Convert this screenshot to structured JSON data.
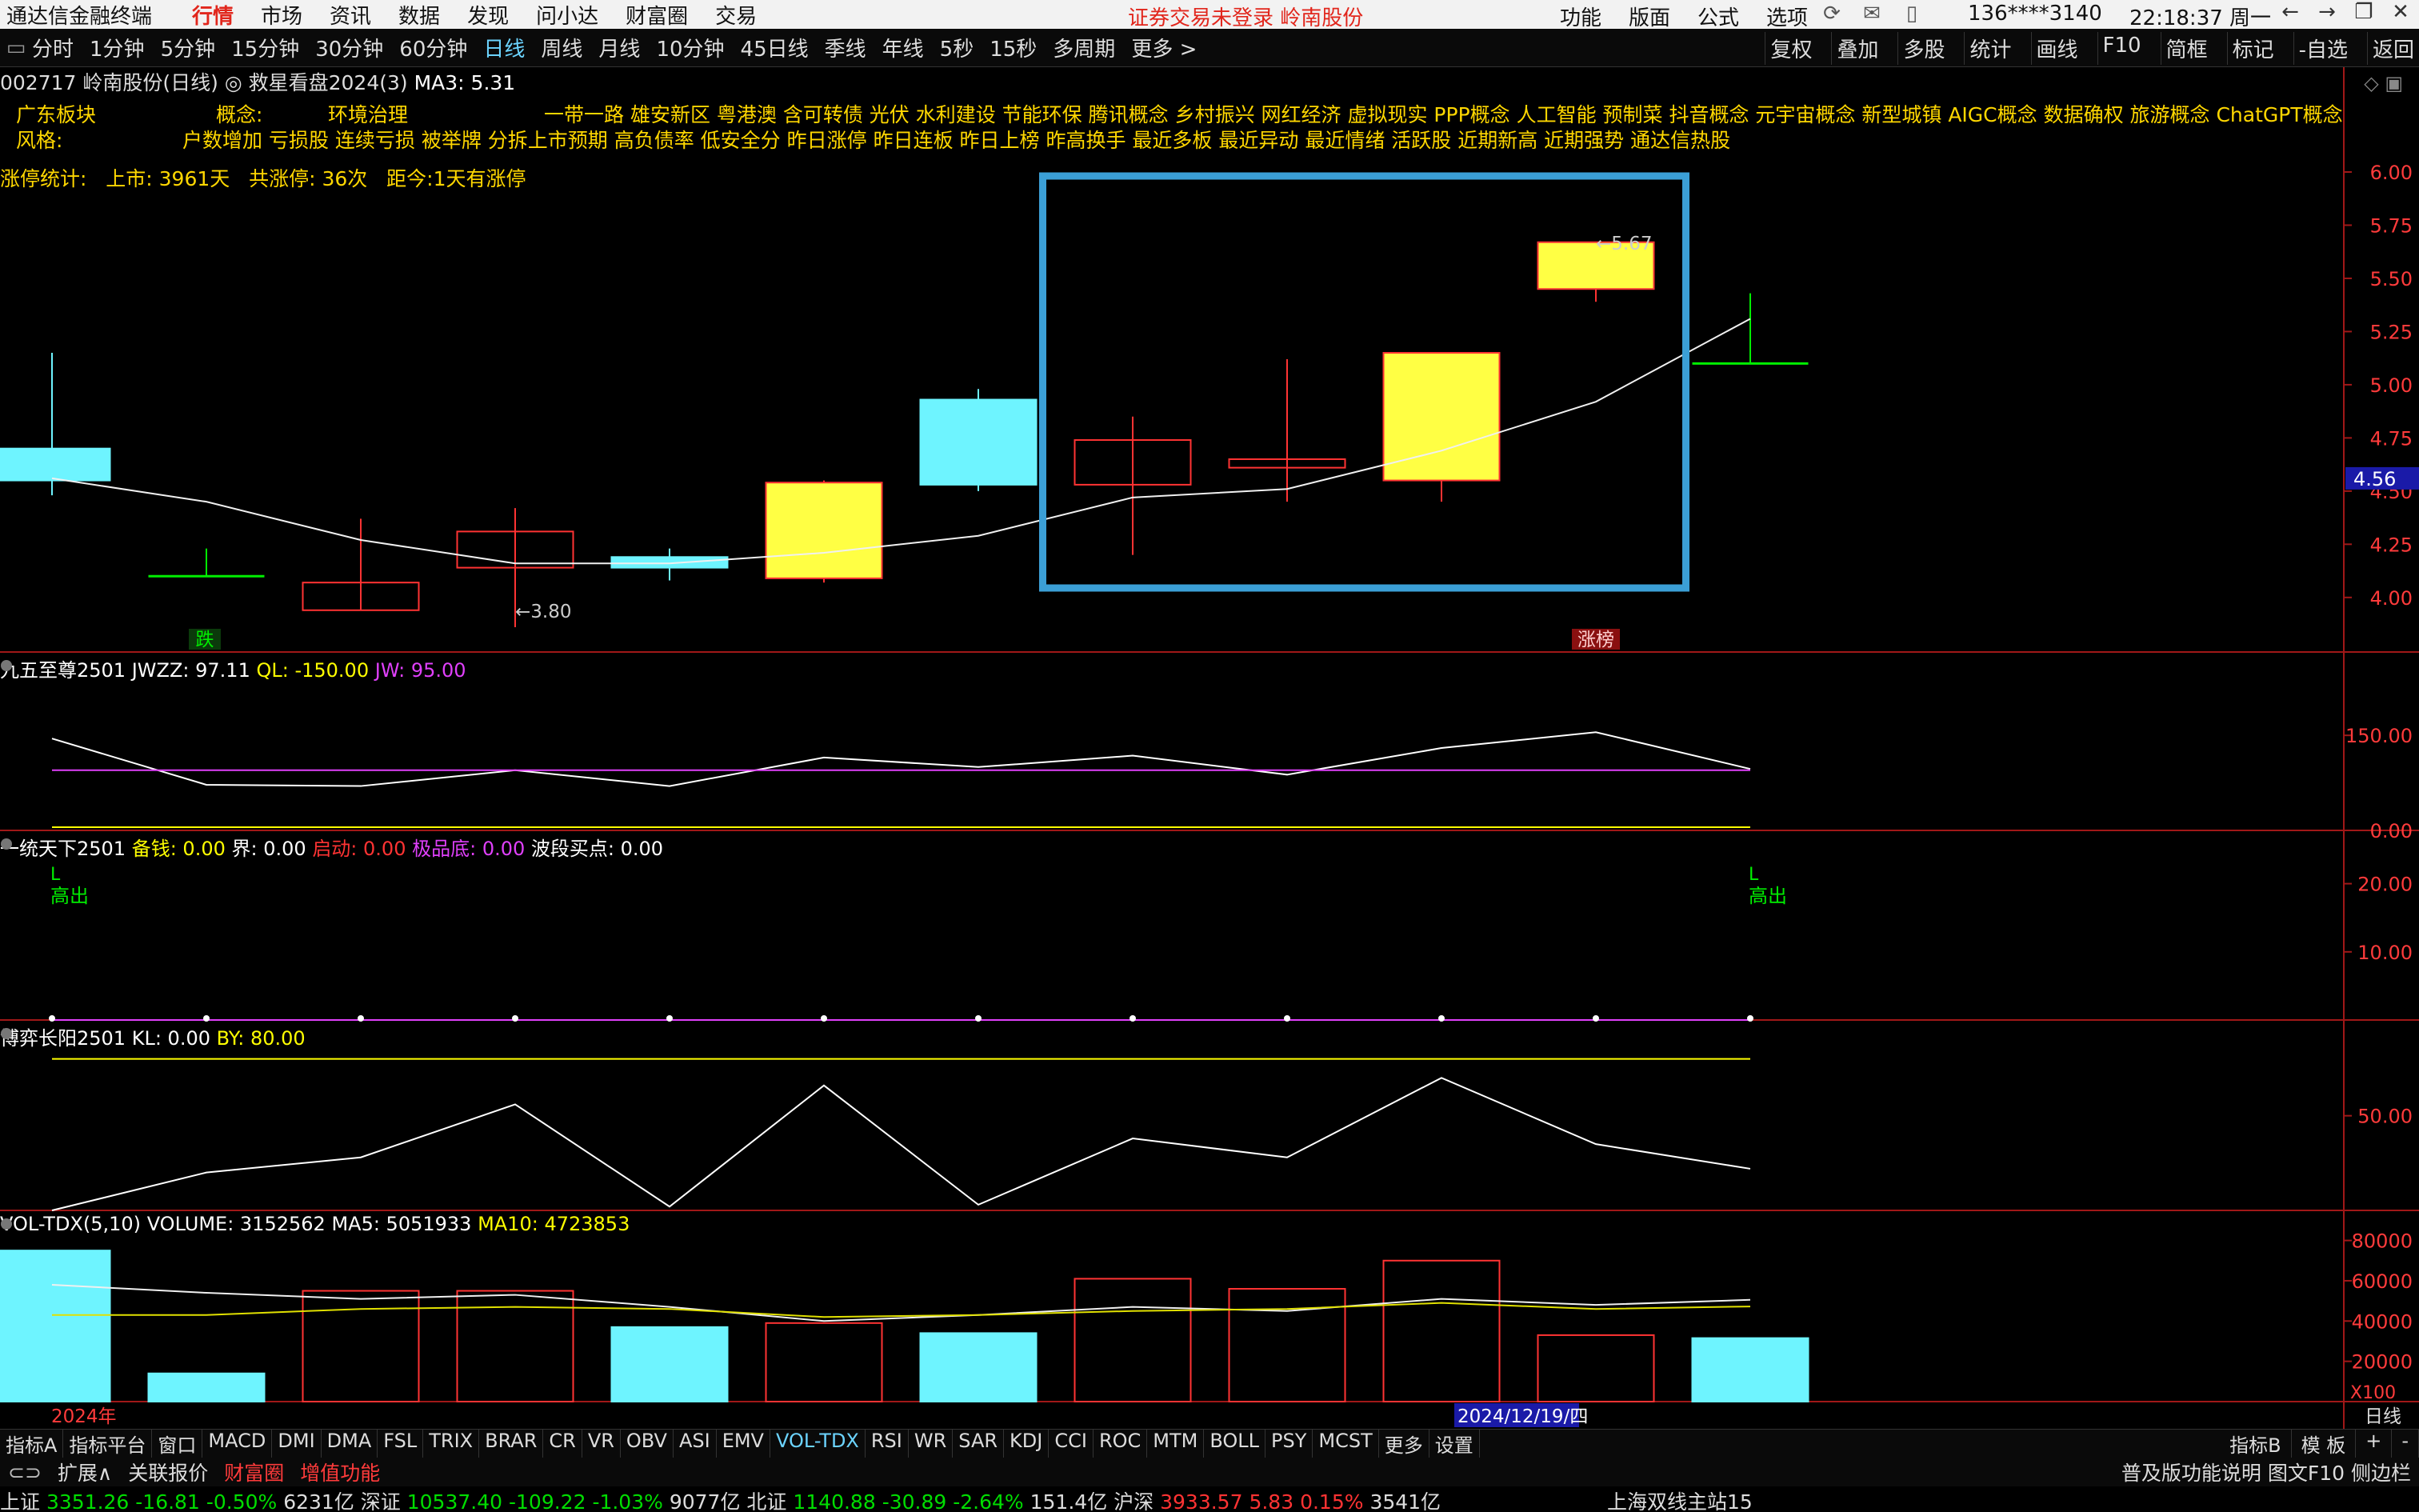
{
  "titlebar": {
    "app_name": "通达信金融终端",
    "menu": [
      "行情",
      "市场",
      "资讯",
      "数据",
      "发现",
      "问小达",
      "财富圈",
      "交易"
    ],
    "active_menu": "行情",
    "notice": "证券交易未登录  岭南股份",
    "right_menu": [
      "功能",
      "版面",
      "公式",
      "选项"
    ],
    "user": "136****3140",
    "clock": "22:18:37 周一"
  },
  "periodbar": {
    "periods": [
      "分时",
      "1分钟",
      "5分钟",
      "15分钟",
      "30分钟",
      "60分钟",
      "日线",
      "周线",
      "月线",
      "10分钟",
      "45日线",
      "季线",
      "年线",
      "5秒",
      "15秒",
      "多周期",
      "更多 >"
    ],
    "active": "日线",
    "tools": [
      "复权",
      "叠加",
      "多股",
      "统计",
      "画线",
      "F10",
      "简框",
      "标记",
      "-自选",
      "返回"
    ]
  },
  "stock": {
    "code_name": "002717 岭南股份(日线)",
    "indicator": "◎ 救星看盘2024(3)",
    "ma3": "MA3: 5.31"
  },
  "concepts": {
    "sector_label": "广东板块",
    "concept_label": "概念:",
    "concept_first": "环境治理",
    "concept_list": "一带一路 雄安新区 粤港澳 含可转债 光伏 水利建设 节能环保 腾讯概念 乡村振兴 网红经济 虚拟现实 PPP概念 人工智能 预制菜 抖音概念 元宇宙概念 新型城镇 AIGC概念 数据确权 旅游概念 ChatGPT概念 数字水印",
    "style_label": "风格:",
    "style_list": "户数增加 亏损股 连续亏损 被举牌 分拆上市预期 高负债率 低安全分 昨日涨停 昨日连板 昨日上榜 昨高换手 最近多板 最近异动 最近情绪 活跃股 近期新高 近期强势 通达信热股"
  },
  "stats": {
    "label": "涨停统计:",
    "listed": "上市: 3961天",
    "limit_up": "共涨停: 36次",
    "since": "距今:1天有涨停"
  },
  "price_axis": [
    "6.00",
    "5.75",
    "5.50",
    "5.25",
    "5.00",
    "4.75",
    "4.56",
    "4.50",
    "4.25",
    "4.00"
  ],
  "chart_data": [
    {
      "type": "candlestick",
      "title": "",
      "ylim": [
        3.8,
        6.0
      ],
      "y_ticks": [
        4.0,
        4.25,
        4.5,
        4.75,
        5.0,
        5.25,
        5.5,
        5.75,
        6.0
      ],
      "current_price": 4.56,
      "candles": [
        {
          "o": 4.55,
          "c": 4.7,
          "h": 5.15,
          "l": 4.48,
          "dir": "down-cyan"
        },
        {
          "o": 4.1,
          "c": 4.1,
          "h": 4.23,
          "l": 4.1,
          "dir": "doji-green"
        },
        {
          "o": 4.07,
          "c": 3.94,
          "h": 4.37,
          "l": 3.94,
          "dir": "up-red-hollow"
        },
        {
          "o": 4.14,
          "c": 4.31,
          "h": 4.42,
          "l": 3.86,
          "dir": "up-red-hollow"
        },
        {
          "o": 4.19,
          "c": 4.14,
          "h": 4.23,
          "l": 4.08,
          "dir": "down-cyan"
        },
        {
          "o": 4.09,
          "c": 4.54,
          "h": 4.55,
          "l": 4.07,
          "dir": "up-yellow"
        },
        {
          "o": 4.93,
          "c": 4.53,
          "h": 4.98,
          "l": 4.5,
          "dir": "down-cyan"
        },
        {
          "o": 4.53,
          "c": 4.74,
          "h": 4.85,
          "l": 4.2,
          "dir": "up-red-hollow"
        },
        {
          "o": 4.61,
          "c": 4.65,
          "h": 5.12,
          "l": 4.45,
          "dir": "up-red-hollow"
        },
        {
          "o": 4.55,
          "c": 5.15,
          "h": 5.15,
          "l": 4.45,
          "dir": "up-yellow"
        },
        {
          "o": 5.45,
          "c": 5.67,
          "h": 5.67,
          "l": 5.39,
          "dir": "up-yellow"
        },
        {
          "o": 5.1,
          "c": 5.1,
          "h": 5.43,
          "l": 5.1,
          "dir": "doji-green"
        }
      ],
      "ma3": [
        4.56,
        4.45,
        4.27,
        4.16,
        4.16,
        4.21,
        4.29,
        4.47,
        4.51,
        4.69,
        4.92,
        5.31
      ],
      "annotations": [
        {
          "label": "←3.80",
          "index": 3
        },
        {
          "label": "←5.67",
          "index": 10
        },
        {
          "label": "跌",
          "index": 1
        },
        {
          "label": "涨榜",
          "index": 10
        }
      ],
      "highlight_box": {
        "from_index": 7,
        "to_index": 10
      }
    },
    {
      "type": "line",
      "title": "九五至尊2501",
      "ylim": [
        0,
        250
      ],
      "y_ticks": [
        0.0,
        150.0
      ],
      "series": [
        {
          "name": "JWZZ",
          "values": [
            145,
            72,
            70,
            95,
            70,
            115,
            100,
            118,
            88,
            130,
            155,
            97
          ],
          "color": "#ffffff"
        },
        {
          "name": "JW",
          "values": [
            95,
            95,
            95,
            95,
            95,
            95,
            95,
            95,
            95,
            95,
            95,
            95
          ],
          "color": "#e040fb"
        }
      ],
      "legend": {
        "jwzz": "JWZZ: 97.11",
        "ql": "QL: -150.00",
        "jw": "JW: 95.00"
      }
    },
    {
      "type": "line",
      "title": "一统天下2501",
      "ylim": [
        0,
        25
      ],
      "y_ticks": [
        10.0,
        20.0
      ],
      "series": [
        {
          "name": "备钱",
          "values": [
            0,
            0,
            0,
            0,
            0,
            0,
            0,
            0,
            0,
            0,
            0,
            0
          ],
          "color": "#e040fb"
        }
      ],
      "legend": {
        "beiqian": "备钱: 0.00",
        "jie": "界: 0.00",
        "qidong": "启动: 0.00",
        "jipindi": "极品底: 0.00",
        "boduan": "波段买点: 0.00"
      },
      "signals": [
        {
          "label": "高出",
          "index": 0
        },
        {
          "label": "高出",
          "index": 11
        }
      ]
    },
    {
      "type": "line",
      "title": "博弈长阳2501",
      "ylim": [
        0,
        90
      ],
      "y_ticks": [
        50.0
      ],
      "series": [
        {
          "name": "KL",
          "values": [
            0,
            20,
            28,
            56,
            2,
            66,
            3,
            38,
            28,
            70,
            35,
            22
          ],
          "color": "#ffffff"
        },
        {
          "name": "BY",
          "values": [
            80,
            80,
            80,
            80,
            80,
            80,
            80,
            80,
            80,
            80,
            80,
            80
          ],
          "color": "#ffff00"
        }
      ],
      "legend": {
        "kl": "KL: 0.00",
        "by": "BY: 80.00"
      }
    },
    {
      "type": "bar",
      "title": "VOL-TDX(5,10)",
      "ylim": [
        0,
        85000
      ],
      "y_ticks": [
        20000,
        40000,
        60000,
        80000
      ],
      "unit": "X100",
      "values": [
        75000,
        14000,
        55000,
        55000,
        37000,
        39000,
        34000,
        61000,
        56000,
        70000,
        33000,
        31525
      ],
      "colors": [
        "cyan",
        "cyan",
        "red",
        "red",
        "cyan",
        "red",
        "cyan",
        "red",
        "red",
        "red",
        "red",
        "cyan"
      ],
      "ma5": [
        58000,
        54000,
        51000,
        53000,
        47000,
        40000,
        43000,
        47000,
        45000,
        51000,
        48000,
        50519
      ],
      "ma10": [
        43000,
        43000,
        46000,
        47000,
        46000,
        42000,
        43000,
        45000,
        46000,
        49000,
        46000,
        47238
      ],
      "legend": {
        "volume": "VOLUME: 3152562",
        "ma5": "MA5: 5051933",
        "ma10": "MA10: 4723853"
      },
      "x_labels": {
        "start": "2024年",
        "cursor": "2024/12/19/四",
        "period": "日线"
      }
    }
  ],
  "bottom_tabs": {
    "tabs": [
      "指标A",
      "指标平台",
      "窗口",
      "MACD",
      "DMI",
      "DMA",
      "FSL",
      "TRIX",
      "BRAR",
      "CR",
      "VR",
      "OBV",
      "ASI",
      "EMV",
      "VOL-TDX",
      "RSI",
      "WR",
      "SAR",
      "KDJ",
      "CCI",
      "ROC",
      "MTM",
      "BOLL",
      "PSY",
      "MCST",
      "更多",
      "设置"
    ],
    "active": "VOL-TDX",
    "right": [
      "指标B",
      "模 板",
      "+",
      "-"
    ]
  },
  "func_bar": {
    "items": [
      "扩展∧",
      "关联报价",
      "财富圈",
      "增值功能"
    ],
    "right_text": "普及版功能说明 图文F10 侧边栏"
  },
  "ticker": {
    "items": [
      {
        "name": "上证",
        "value": "3351.26",
        "chg": "-16.81",
        "pct": "-0.50%",
        "amt": "6231亿",
        "dir": "down"
      },
      {
        "name": "深证",
        "value": "10537.40",
        "chg": "-109.22",
        "pct": "-1.03%",
        "amt": "9077亿",
        "dir": "down"
      },
      {
        "name": "北证",
        "value": "1140.88",
        "chg": "-30.89",
        "pct": "-2.64%",
        "amt": "151.4亿",
        "dir": "down"
      },
      {
        "name": "沪深",
        "value": "3933.57",
        "chg": "5.83",
        "pct": "0.15%",
        "amt": "3541亿",
        "dir": "up"
      }
    ],
    "server": "上海双线主站15"
  }
}
